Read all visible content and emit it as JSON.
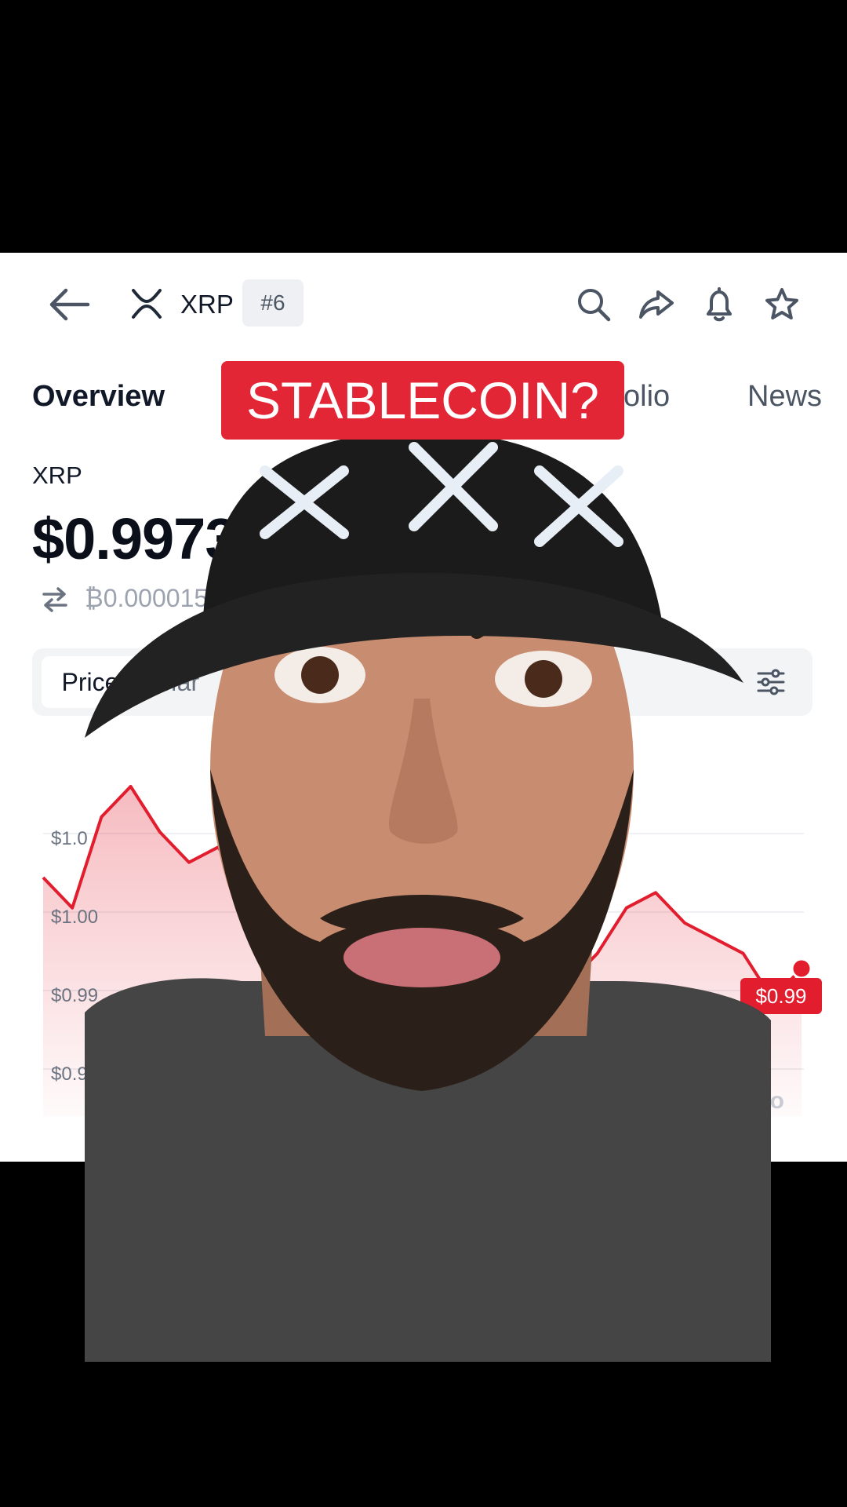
{
  "header": {
    "coin_name": "XRP",
    "rank": "#6",
    "icons": [
      "back-arrow-icon",
      "xrp-logo-icon",
      "search-icon",
      "share-icon",
      "bell-icon",
      "star-icon"
    ]
  },
  "tabs": [
    "Overview",
    "olio",
    "News"
  ],
  "coin": {
    "symbol": "XRP",
    "price": "$0.9973",
    "btc_price": "₿0.0000155"
  },
  "segment": {
    "price_label": "Price",
    "market_label": "Mar"
  },
  "overlay_text": "STABLECOIN?",
  "chart_data": {
    "type": "area",
    "color": "#e11d2e",
    "y_tick_labels": [
      "$1.0",
      "$1.00",
      "$0.99",
      "$0.99"
    ],
    "current_label": "$0.99",
    "watermark": "oingecko",
    "series": [
      {
        "values": [
          1.0,
          0.998,
          1.004,
          1.006,
          1.003,
          1.001,
          1.002,
          0.999,
          1.0,
          0.999,
          0.998,
          0.997,
          0.996,
          0.995,
          0.994,
          0.993,
          0.992,
          0.991,
          0.993,
          0.995,
          0.998,
          0.999,
          0.997,
          0.996,
          0.995,
          0.992,
          0.994
        ]
      }
    ]
  }
}
